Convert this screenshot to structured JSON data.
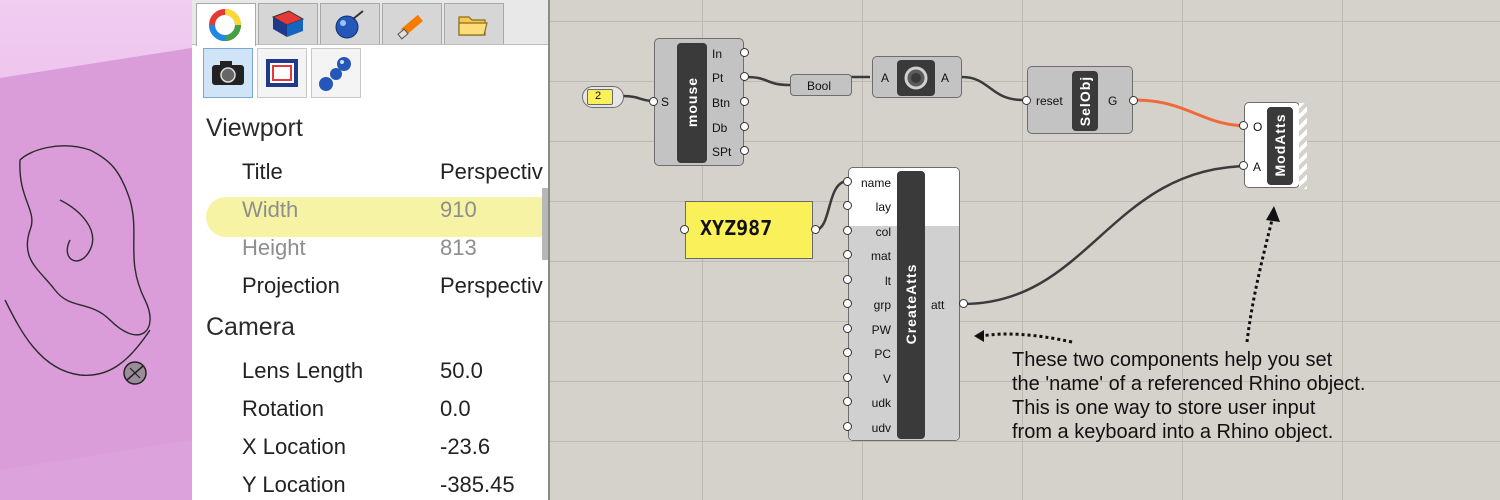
{
  "properties_panel": {
    "tabs": [
      "color-wheel-icon",
      "layer-icon",
      "material-icon",
      "light-icon",
      "folder-icon"
    ],
    "subtabs": [
      "camera-icon",
      "display-frame-icon",
      "render-spheres-icon"
    ],
    "sections": [
      {
        "title": "Viewport",
        "rows": [
          {
            "label": "Title",
            "value": "Perspectiv"
          },
          {
            "label": "Width",
            "value": "910"
          },
          {
            "label": "Height",
            "value": "813"
          },
          {
            "label": "Projection",
            "value": "Perspectiv"
          }
        ]
      },
      {
        "title": "Camera",
        "rows": [
          {
            "label": "Lens Length",
            "value": "50.0"
          },
          {
            "label": "Rotation",
            "value": "0.0"
          },
          {
            "label": "X Location",
            "value": "-23.6"
          },
          {
            "label": "Y Location",
            "value": "-385.45"
          }
        ]
      }
    ]
  },
  "canvas": {
    "number_slider": {
      "value": "2"
    },
    "mouse_component": {
      "title": "mouse",
      "input": "S",
      "outputs": [
        "In",
        "Pt",
        "Btn",
        "Db",
        "SPt"
      ]
    },
    "bool_param": {
      "label": "Bool"
    },
    "toggle_component": {
      "input": "A",
      "output": "A"
    },
    "selobj_component": {
      "title": "SelObj",
      "input": "reset",
      "output": "G"
    },
    "modatts_component": {
      "title": "ModAtts",
      "inputs": [
        "O",
        "A"
      ]
    },
    "text_panel": {
      "value": "XYZ987"
    },
    "createatts_component": {
      "title": "CreateAtts",
      "inputs": [
        "name",
        "lay",
        "col",
        "mat",
        "lt",
        "grp",
        "PW",
        "PC",
        "V",
        "udk",
        "udv"
      ],
      "output": "att"
    },
    "annotation": "These two components help you set\nthe 'name' of a referenced Rhino object.\nThis is one way to store user input\nfrom a keyboard into a Rhino object."
  },
  "colors": {
    "highlight": "#f5f29a",
    "wire_selected": "#ee6a3a",
    "panel_yellow": "#faf05a",
    "viewport_pink": "#e2a6e2"
  }
}
